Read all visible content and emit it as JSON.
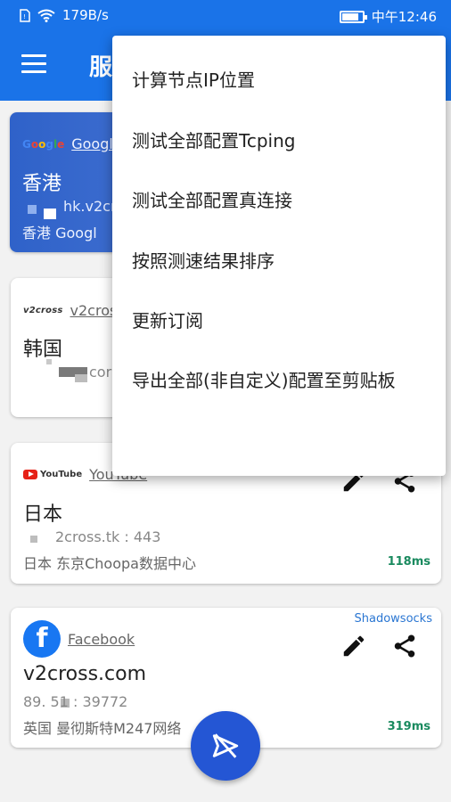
{
  "status_bar": {
    "network_speed": "179B/s",
    "time": "中午12:46",
    "sim_icon": "sim-card-icon",
    "wifi_icon": "wifi-icon",
    "battery_icon": "battery-icon"
  },
  "app_bar": {
    "title": "服",
    "menu_icon": "hamburger-menu-icon"
  },
  "servers": [
    {
      "logo_text": "Google",
      "site": "Google",
      "name": "香港",
      "address": "hk.v2cro",
      "location": "香港  Googl",
      "selected": true
    },
    {
      "logo_text": "v2cross",
      "site": "v2cros",
      "name": "韩国",
      "address": "cor"
    },
    {
      "logo_text": "YouTube",
      "site": "YouTube",
      "name": "日本",
      "address": "2cross.tk : 443",
      "location": "日本   东京Choopa数据中心",
      "latency": "118ms"
    },
    {
      "logo_text": "f",
      "site": "Facebook",
      "name": "v2cross.com",
      "address": "89.         51 : 39772",
      "location": "英国   曼彻斯特M247网络",
      "latency": "319ms",
      "protocol": "Shadowsocks"
    }
  ],
  "actions": {
    "edit_icon": "pencil-edit-icon",
    "share_icon": "share-icon"
  },
  "fab": {
    "icon": "paper-plane-off-icon"
  },
  "popup_menu": {
    "items": [
      "计算节点IP位置",
      "测试全部配置Tcping",
      "测试全部配置真连接",
      "按照测速结果排序",
      "更新订阅",
      "导出全部(非自定义)配置至剪贴板"
    ]
  },
  "colors": {
    "primary": "#1a73e8",
    "latency_green": "#1a8a5f",
    "fab": "#2456d4"
  }
}
